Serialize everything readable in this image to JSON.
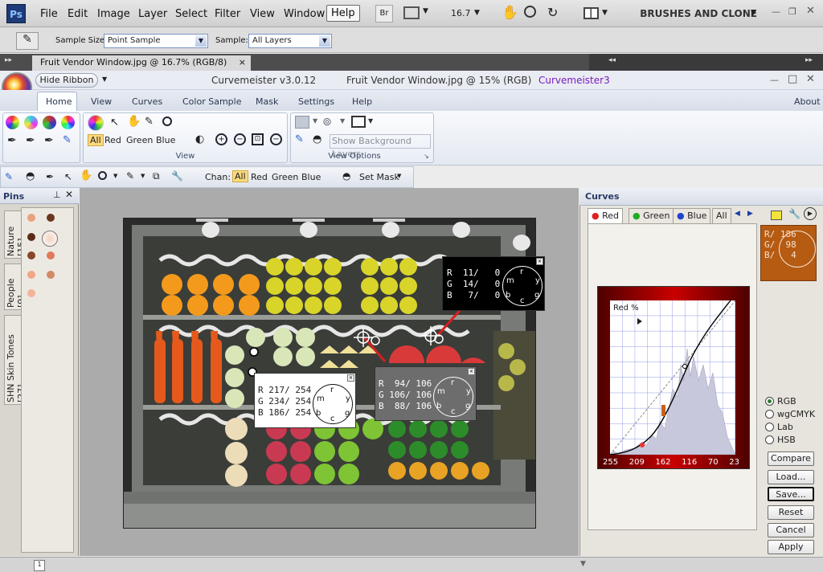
{
  "photoshop": {
    "logo": "Ps",
    "menus": [
      "File",
      "Edit",
      "Image",
      "Layer",
      "Select",
      "Filter",
      "View",
      "Window",
      "Help"
    ],
    "bridge_label": "Br",
    "zoom": "16.7",
    "workspace": "BRUSHES AND CLONE"
  },
  "options_bar": {
    "sample_size_label": "Sample Size:",
    "sample_size_value": "Point Sample",
    "sample_label": "Sample:",
    "sample_value": "All Layers"
  },
  "document_tab": {
    "label": "Fruit Vendor Window.jpg @ 16.7% (RGB/8)",
    "close": "×"
  },
  "curvemeister": {
    "hide_ribbon": "Hide Ribbon",
    "app_title": "Curvemeister v3.0.12",
    "doc_title": "Fruit Vendor Window.jpg @ 15% (RGB)",
    "plugin_name": "Curvemeister3",
    "ribbon_tabs": [
      "Home",
      "View",
      "Curves",
      "Color Sample",
      "Mask",
      "Settings",
      "Help"
    ],
    "about": "About",
    "channels": [
      "All",
      "Red",
      "Green",
      "Blue"
    ],
    "group_view": "View",
    "group_view_options": "View Options",
    "show_bg_layers": "Show Background Layers",
    "chan_label": "Chan:",
    "set_mask": "Set Mask"
  },
  "pins_panel": {
    "title": "Pins",
    "tabs": [
      "Nature [15]",
      "People [9]",
      "SHN Skin Tones [27]"
    ]
  },
  "samplers": {
    "s1": {
      "r": "R  11/   0",
      "g": "G  14/   0",
      "b": "B   7/   0"
    },
    "s2": {
      "r": "R 217/ 254",
      "g": "G 234/ 254",
      "b": "B 186/ 254"
    },
    "s3": {
      "r": "R  94/ 106",
      "g": "G 106/ 106",
      "b": "B  88/ 106"
    },
    "dial_letters": {
      "r": "r",
      "y": "y",
      "g": "g",
      "c": "c",
      "b": "b",
      "m": "m"
    }
  },
  "curves_panel": {
    "title": "Curves",
    "tabs": [
      "Red",
      "Green",
      "Blue",
      "All"
    ],
    "graph_label": "Red %",
    "x_ticks": [
      "255",
      "209",
      "162",
      "116",
      "70",
      "23"
    ],
    "readout": {
      "r": "R/ 186",
      "g": "G/  98",
      "b": "B/   4"
    },
    "color_spaces": [
      "RGB",
      "wgCMYK",
      "Lab",
      "HSB"
    ],
    "selected_space": "RGB",
    "buttons": [
      "Compare",
      "Load...",
      "Save...",
      "Reset",
      "Cancel",
      "Apply"
    ]
  },
  "status": {
    "page": "1"
  }
}
